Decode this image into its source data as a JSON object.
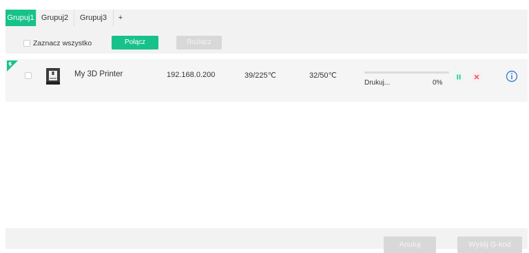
{
  "tabs": [
    {
      "label": "Grupuj1",
      "active": true
    },
    {
      "label": "Grupuj2",
      "active": false
    },
    {
      "label": "Grupuj3",
      "active": false
    },
    {
      "label": "+",
      "active": false
    }
  ],
  "toolbar": {
    "select_all_label": "Zaznacz wszystko",
    "connect_label": "Połącz",
    "disconnect_label": "Rozłącz"
  },
  "printers": [
    {
      "name": "My 3D Printer",
      "ip": "192.168.0.200",
      "nozzle_temp": "39/225℃",
      "bed_temp": "32/50℃",
      "status": "Drukuj...",
      "progress_text": "0%",
      "progress_value": 0
    }
  ],
  "footer": {
    "cancel_label": "Anuluj",
    "send_gcode_label": "Wyślij G-kod"
  },
  "colors": {
    "accent": "#17c28a",
    "danger": "#e8505b",
    "info": "#3b7ddd",
    "disabled": "#d8d8d8"
  },
  "icons": {
    "printer": "3d-printer-icon",
    "pause": "pause-icon",
    "stop": "close-icon",
    "info": "info-icon",
    "flag": "corner-flag-icon"
  }
}
